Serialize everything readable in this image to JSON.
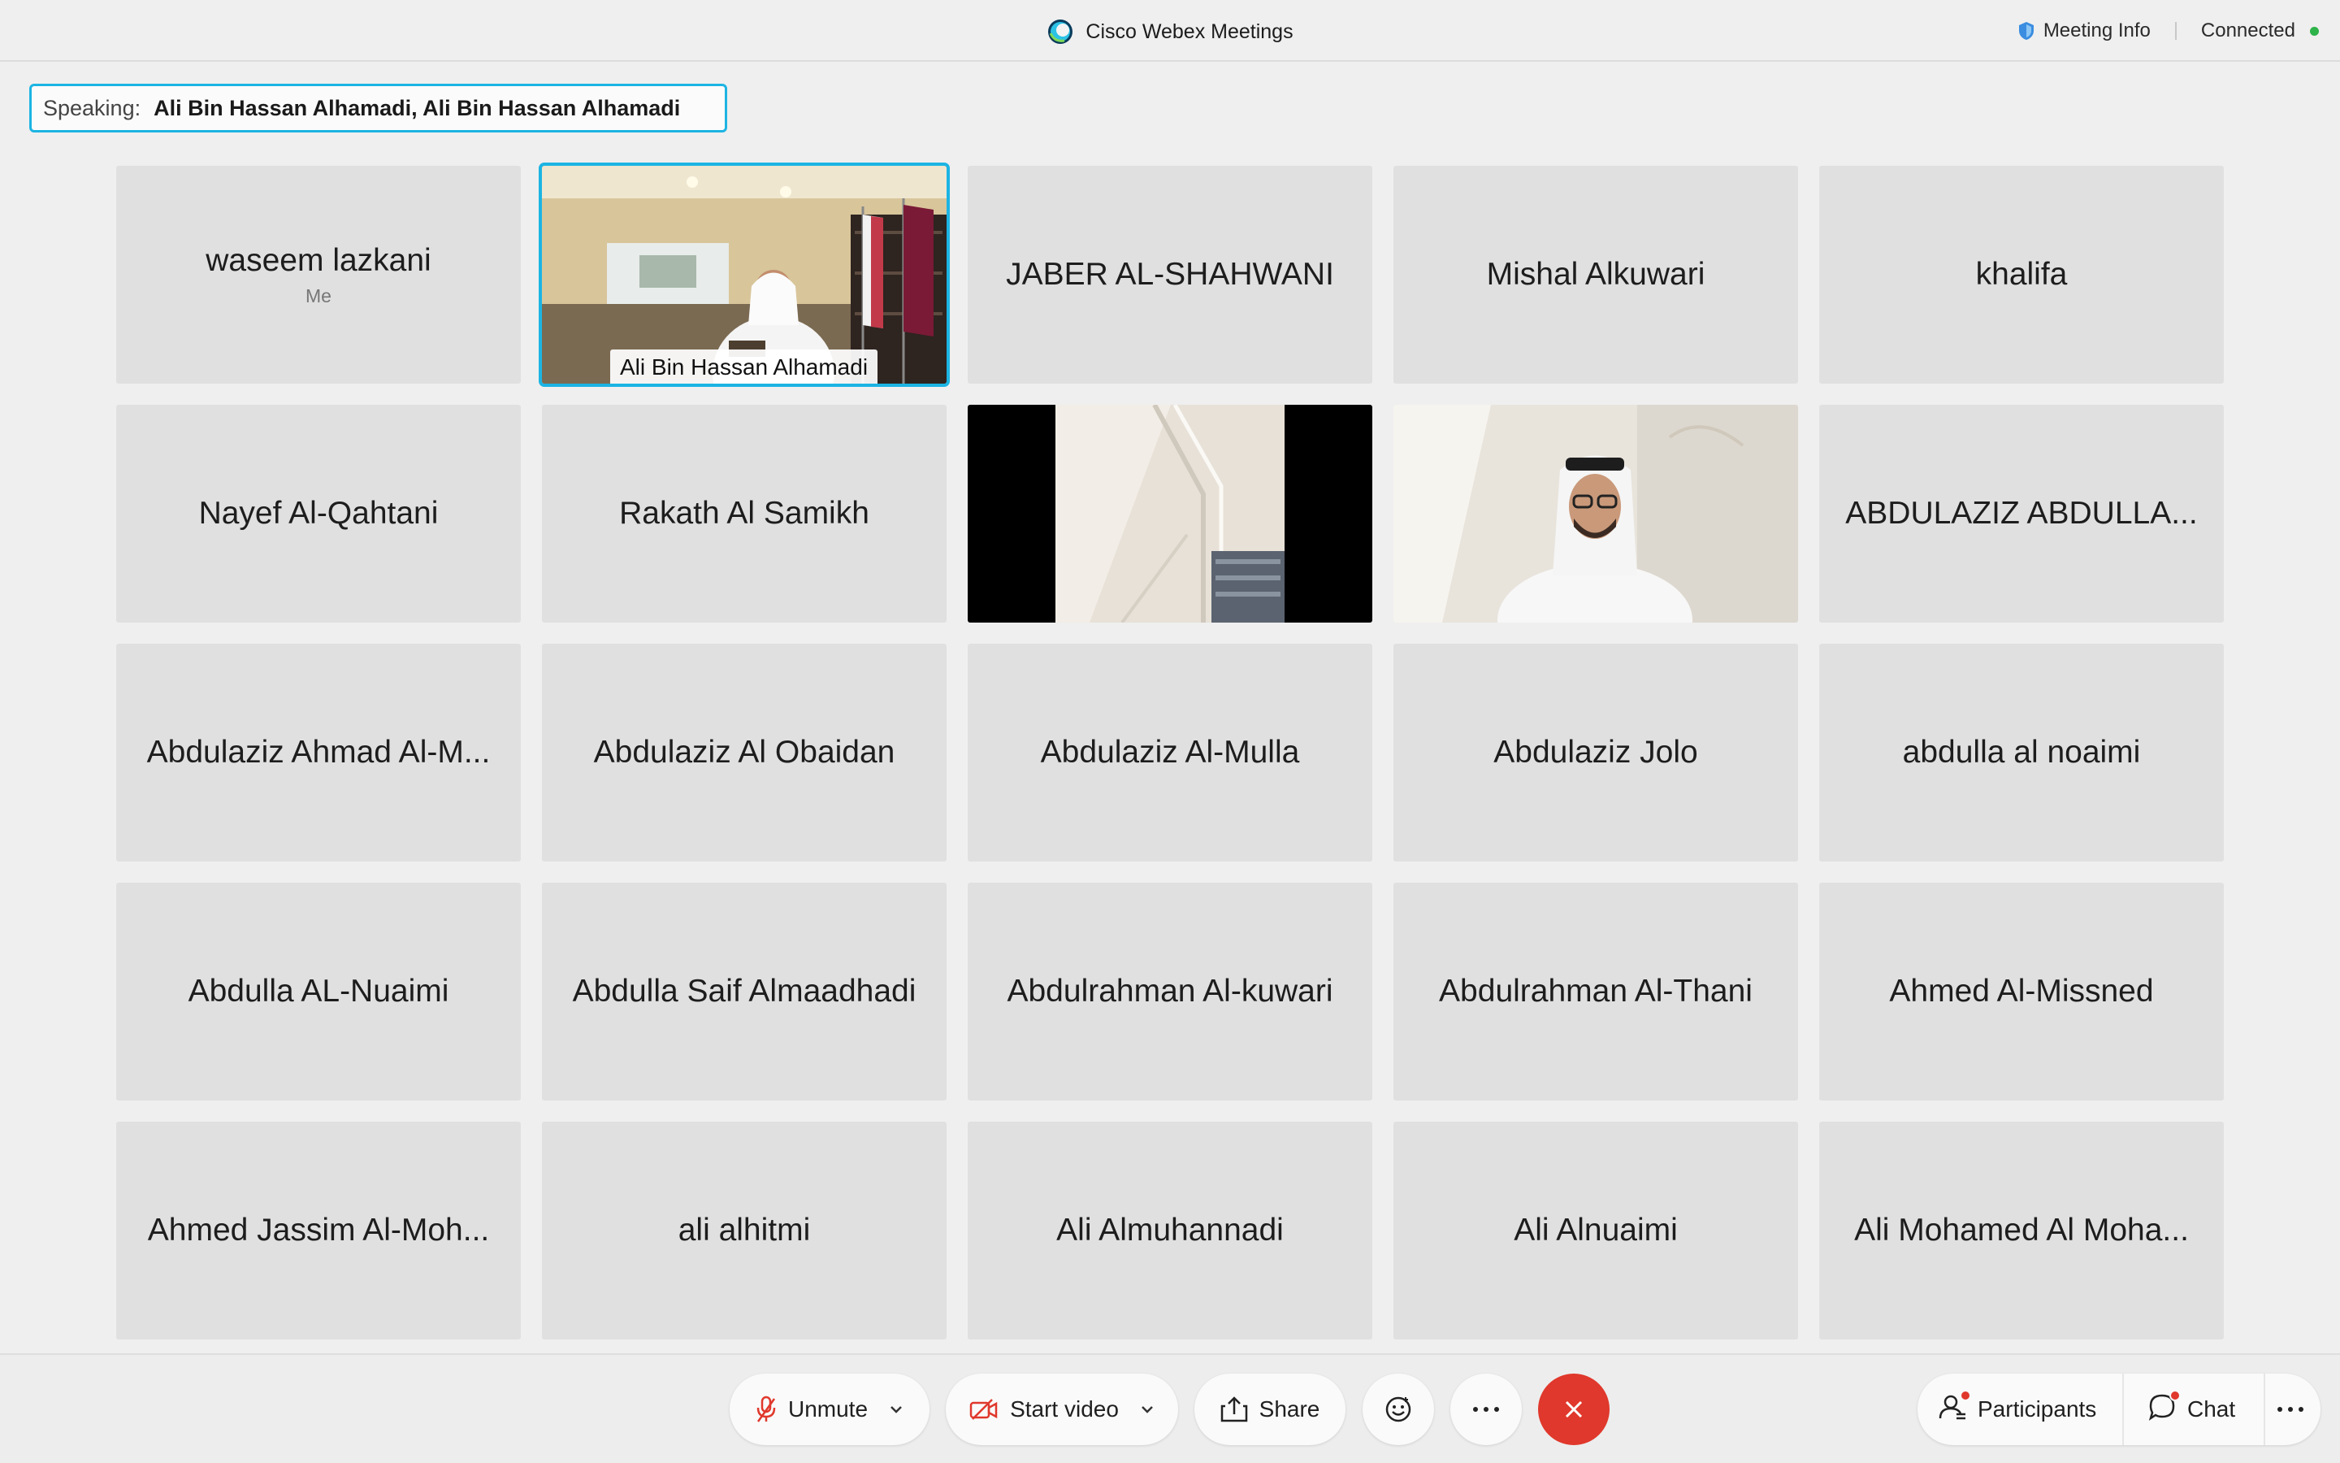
{
  "window": {
    "app_title": "Cisco Webex Meetings",
    "meeting_info_label": "Meeting Info",
    "connection_status": "Connected"
  },
  "speaking": {
    "label": "Speaking:",
    "names": "Ali Bin Hassan Alhamadi,   Ali Bin Hassan Alhamadi"
  },
  "participants": [
    {
      "name": "waseem lazkani",
      "sub": "Me"
    },
    {
      "name": "Ali Bin Hassan Alhamadi",
      "video": true,
      "active": true
    },
    {
      "name": "JABER AL-SHAHWANI"
    },
    {
      "name": "Mishal Alkuwari"
    },
    {
      "name": "khalifa"
    },
    {
      "name": "Nayef Al-Qahtani"
    },
    {
      "name": "Rakath Al Samikh"
    },
    {
      "name": "",
      "video": true
    },
    {
      "name": "",
      "video": true
    },
    {
      "name": "ABDULAZIZ ABDULLA..."
    },
    {
      "name": "Abdulaziz Ahmad Al-M..."
    },
    {
      "name": "Abdulaziz Al Obaidan"
    },
    {
      "name": "Abdulaziz Al-Mulla"
    },
    {
      "name": "Abdulaziz Jolo"
    },
    {
      "name": "abdulla al noaimi"
    },
    {
      "name": "Abdulla AL-Nuaimi"
    },
    {
      "name": "Abdulla Saif Almaadhadi"
    },
    {
      "name": "Abdulrahman Al-kuwari"
    },
    {
      "name": "Abdulrahman Al-Thani"
    },
    {
      "name": "Ahmed Al-Missned"
    },
    {
      "name": "Ahmed Jassim Al-Moh..."
    },
    {
      "name": "ali alhitmi"
    },
    {
      "name": "Ali Almuhannadi"
    },
    {
      "name": "Ali Alnuaimi"
    },
    {
      "name": "Ali Mohamed Al Moha..."
    }
  ],
  "controls": {
    "unmute": "Unmute",
    "start_video": "Start video",
    "share": "Share",
    "participants": "Participants",
    "chat": "Chat"
  },
  "icons": {
    "microphone": "mic-muted-icon",
    "video": "video-off-icon",
    "share": "share-icon",
    "reactions": "smiley-icon",
    "more": "more-icon",
    "end": "close-icon"
  },
  "colors": {
    "accent": "#1cb4e3",
    "end_call": "#e0382c",
    "mute_red": "#e0382c",
    "connected": "#2eb24a"
  }
}
